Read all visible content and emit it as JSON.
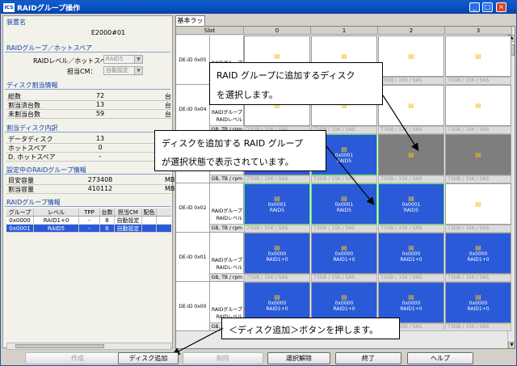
{
  "window": {
    "title": "RAIDグループ操作",
    "logo": "ICS"
  },
  "left": {
    "device_section": "装置名",
    "device_name": "E2000#01",
    "raid_section": "RAIDグループ／ホットスペア",
    "raid_level_label": "RAIDレベル／ホットスペア：",
    "raid_level_value": "RAID5",
    "cm_label": "担当CM：",
    "cm_value": "自動設定",
    "disk_section": "ディスク割当情報",
    "disk_rows": [
      {
        "label": "総数",
        "value": "72",
        "unit": "台"
      },
      {
        "label": "割当済台数",
        "value": "13",
        "unit": "台"
      },
      {
        "label": "未割当台数",
        "value": "59",
        "unit": "台"
      }
    ],
    "assign_section": "割当ディスク内訳",
    "assign_rows": [
      {
        "label": "データディスク",
        "value": "13",
        "unit": "台"
      },
      {
        "label": "ホットスペア",
        "value": "0",
        "unit": "台"
      },
      {
        "label": "D. ホットスペア",
        "value": "-",
        "unit": "台"
      }
    ],
    "capacity_section": "設定中のRAIDグループ情報",
    "capacity_rows": [
      {
        "label": "目安容量",
        "value": "273408",
        "unit": "MB"
      },
      {
        "label": "割当容量",
        "value": "410112",
        "unit": "MB"
      }
    ],
    "group_section": "RAIDグループ情報",
    "group_headers": [
      "グループ",
      "レベル",
      "TPP",
      "台数",
      "担当CM",
      "配色"
    ],
    "group_rows": [
      [
        "0x0000",
        "RAID1+0",
        "-",
        "8",
        "自動設定",
        ""
      ],
      [
        "0x0001",
        "RAID5",
        "-",
        "6",
        "自動設定",
        ""
      ]
    ]
  },
  "right": {
    "tab_label": "基本ラック",
    "slot_header": "Slot",
    "columns": [
      "0",
      "1",
      "2",
      "3"
    ],
    "row_meta_labels": [
      "RAIDグループ",
      "RAIDレベル",
      "GB, TB / rpm"
    ],
    "rows": [
      {
        "de": "DE-ID 0x05",
        "cells": [
          {
            "type": "white",
            "group": "",
            "level": "",
            "cap": "73GB / 15K / SAS"
          },
          {
            "type": "white",
            "group": "",
            "level": "",
            "cap": "73GB / 15K / SAS"
          },
          {
            "type": "white",
            "group": "",
            "level": "",
            "cap": "73GB / 15K / SAS"
          },
          {
            "type": "white",
            "group": "",
            "level": "",
            "cap": "73GB / 15K / SAS"
          }
        ]
      },
      {
        "de": "DE-ID 0x04",
        "cells": [
          {
            "type": "white",
            "group": "",
            "level": "",
            "cap": "73GB / 15K / SAS"
          },
          {
            "type": "white",
            "group": "",
            "level": "",
            "cap": "73GB / 15K / SAS"
          },
          {
            "type": "white",
            "group": "",
            "level": "",
            "cap": "73GB / 15K / SAS"
          },
          {
            "type": "white",
            "group": "",
            "level": "",
            "cap": "73GB / 15K / SAS"
          }
        ]
      },
      {
        "de": "DE-ID 0x03",
        "cells": [
          {
            "type": "blue",
            "group": "0x0001",
            "level": "RAID5",
            "cap": "73GB / 15K / SAS"
          },
          {
            "type": "blue-hl",
            "group": "0x0001",
            "level": "RAID5",
            "cap": "73GB / 15K / SAS"
          },
          {
            "type": "gray",
            "group": "",
            "level": "",
            "cap": "73GB / 15K / SAS"
          },
          {
            "type": "gray",
            "group": "",
            "level": "",
            "cap": "73GB / 15K / SAS"
          }
        ]
      },
      {
        "de": "DE-ID 0x02",
        "cells": [
          {
            "type": "blue-hl",
            "group": "0x0001",
            "level": "RAID5",
            "cap": "73GB / 15K / SAS"
          },
          {
            "type": "blue-hl",
            "group": "0x0001",
            "level": "RAID5",
            "cap": "73GB / 15K / SAS"
          },
          {
            "type": "blue-hl",
            "group": "0x0001",
            "level": "RAID5",
            "cap": "73GB / 15K / SAS"
          },
          {
            "type": "white",
            "group": "",
            "level": "",
            "cap": "73GB / 15K / SAS"
          }
        ]
      },
      {
        "de": "DE-ID 0x01",
        "cells": [
          {
            "type": "blue",
            "group": "0x0000",
            "level": "RAID1+0",
            "cap": "73GB / 15K / SAS"
          },
          {
            "type": "blue",
            "group": "0x0000",
            "level": "RAID1+0",
            "cap": "73GB / 15K / SAS"
          },
          {
            "type": "blue",
            "group": "0x0000",
            "level": "RAID1+0",
            "cap": "73GB / 15K / SAS"
          },
          {
            "type": "blue",
            "group": "0x0000",
            "level": "RAID1+0",
            "cap": "73GB / 15K / SAS"
          }
        ]
      },
      {
        "de": "DE-ID 0x00",
        "cells": [
          {
            "type": "blue",
            "group": "0x0000",
            "level": "RAID1+0",
            "cap": "73GB / 15K / SAS"
          },
          {
            "type": "blue",
            "group": "0x0000",
            "level": "RAID1+0",
            "cap": "73GB / 15K / SAS"
          },
          {
            "type": "blue",
            "group": "0x0000",
            "level": "RAID1+0",
            "cap": "73GB / 15K / SAS"
          },
          {
            "type": "blue",
            "group": "0x0000",
            "level": "RAID1+0",
            "cap": "73GB / 15K / SAS"
          }
        ]
      }
    ]
  },
  "callouts": {
    "select_disk": [
      "RAID グループに追加するディスク",
      "を選択します。"
    ],
    "selected_group": [
      "ディスクを追加する RAID グループ",
      "が選択状態で表示されています。"
    ],
    "press_button": "＜ディスク追加＞ボタンを押します。"
  },
  "buttons": {
    "create": "作成",
    "add_disk": "ディスク追加",
    "delete": "削除",
    "deselect": "選択解除",
    "finish": "終了",
    "help": "ヘルプ"
  },
  "colors": {
    "selected_blue": "#2a5ad8",
    "highlight_green": "#5ae86a",
    "title_blue": "#0842a8"
  }
}
